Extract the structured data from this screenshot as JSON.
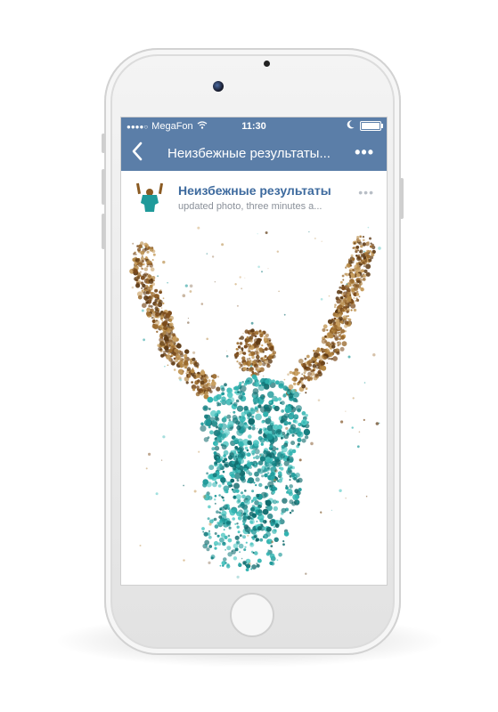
{
  "statusbar": {
    "signal": "●●●●○",
    "carrier": "MegaFon",
    "time": "11:30"
  },
  "navbar": {
    "back_icon": "chevron-left-icon",
    "title": "Неизбежные результаты...",
    "more_label": "•••"
  },
  "post": {
    "author": "Неизбежные результаты",
    "subtitle": "updated photo, three minutes a...",
    "more_label": "•••"
  },
  "colors": {
    "nav_blue": "#5b7ea8",
    "link_blue": "#3d6a9e",
    "shirt_teal": "#1f9a9a",
    "skin_brown": "#8a5a22"
  }
}
